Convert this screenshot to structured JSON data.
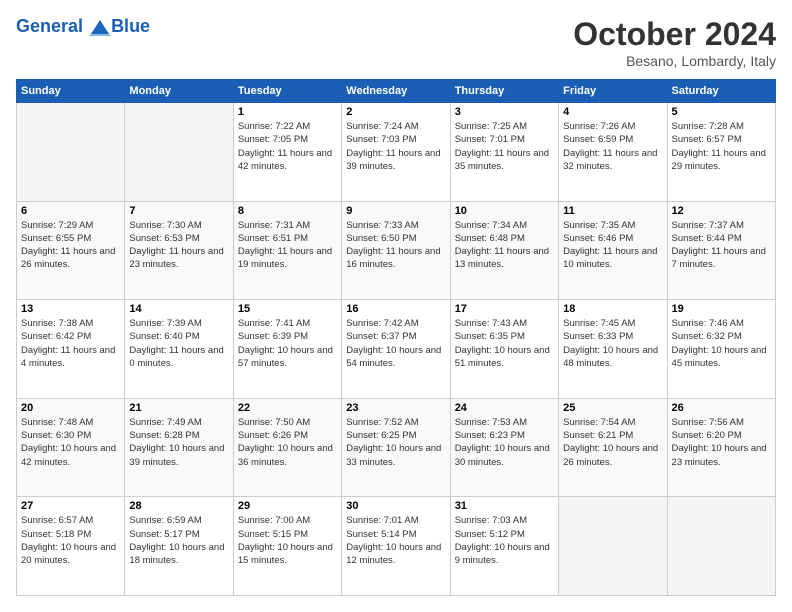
{
  "header": {
    "logo_line1": "General",
    "logo_line2": "Blue",
    "month": "October 2024",
    "location": "Besano, Lombardy, Italy"
  },
  "days_of_week": [
    "Sunday",
    "Monday",
    "Tuesday",
    "Wednesday",
    "Thursday",
    "Friday",
    "Saturday"
  ],
  "weeks": [
    [
      {
        "day": "",
        "info": ""
      },
      {
        "day": "",
        "info": ""
      },
      {
        "day": "1",
        "info": "Sunrise: 7:22 AM\nSunset: 7:05 PM\nDaylight: 11 hours and 42 minutes."
      },
      {
        "day": "2",
        "info": "Sunrise: 7:24 AM\nSunset: 7:03 PM\nDaylight: 11 hours and 39 minutes."
      },
      {
        "day": "3",
        "info": "Sunrise: 7:25 AM\nSunset: 7:01 PM\nDaylight: 11 hours and 35 minutes."
      },
      {
        "day": "4",
        "info": "Sunrise: 7:26 AM\nSunset: 6:59 PM\nDaylight: 11 hours and 32 minutes."
      },
      {
        "day": "5",
        "info": "Sunrise: 7:28 AM\nSunset: 6:57 PM\nDaylight: 11 hours and 29 minutes."
      }
    ],
    [
      {
        "day": "6",
        "info": "Sunrise: 7:29 AM\nSunset: 6:55 PM\nDaylight: 11 hours and 26 minutes."
      },
      {
        "day": "7",
        "info": "Sunrise: 7:30 AM\nSunset: 6:53 PM\nDaylight: 11 hours and 23 minutes."
      },
      {
        "day": "8",
        "info": "Sunrise: 7:31 AM\nSunset: 6:51 PM\nDaylight: 11 hours and 19 minutes."
      },
      {
        "day": "9",
        "info": "Sunrise: 7:33 AM\nSunset: 6:50 PM\nDaylight: 11 hours and 16 minutes."
      },
      {
        "day": "10",
        "info": "Sunrise: 7:34 AM\nSunset: 6:48 PM\nDaylight: 11 hours and 13 minutes."
      },
      {
        "day": "11",
        "info": "Sunrise: 7:35 AM\nSunset: 6:46 PM\nDaylight: 11 hours and 10 minutes."
      },
      {
        "day": "12",
        "info": "Sunrise: 7:37 AM\nSunset: 6:44 PM\nDaylight: 11 hours and 7 minutes."
      }
    ],
    [
      {
        "day": "13",
        "info": "Sunrise: 7:38 AM\nSunset: 6:42 PM\nDaylight: 11 hours and 4 minutes."
      },
      {
        "day": "14",
        "info": "Sunrise: 7:39 AM\nSunset: 6:40 PM\nDaylight: 11 hours and 0 minutes."
      },
      {
        "day": "15",
        "info": "Sunrise: 7:41 AM\nSunset: 6:39 PM\nDaylight: 10 hours and 57 minutes."
      },
      {
        "day": "16",
        "info": "Sunrise: 7:42 AM\nSunset: 6:37 PM\nDaylight: 10 hours and 54 minutes."
      },
      {
        "day": "17",
        "info": "Sunrise: 7:43 AM\nSunset: 6:35 PM\nDaylight: 10 hours and 51 minutes."
      },
      {
        "day": "18",
        "info": "Sunrise: 7:45 AM\nSunset: 6:33 PM\nDaylight: 10 hours and 48 minutes."
      },
      {
        "day": "19",
        "info": "Sunrise: 7:46 AM\nSunset: 6:32 PM\nDaylight: 10 hours and 45 minutes."
      }
    ],
    [
      {
        "day": "20",
        "info": "Sunrise: 7:48 AM\nSunset: 6:30 PM\nDaylight: 10 hours and 42 minutes."
      },
      {
        "day": "21",
        "info": "Sunrise: 7:49 AM\nSunset: 6:28 PM\nDaylight: 10 hours and 39 minutes."
      },
      {
        "day": "22",
        "info": "Sunrise: 7:50 AM\nSunset: 6:26 PM\nDaylight: 10 hours and 36 minutes."
      },
      {
        "day": "23",
        "info": "Sunrise: 7:52 AM\nSunset: 6:25 PM\nDaylight: 10 hours and 33 minutes."
      },
      {
        "day": "24",
        "info": "Sunrise: 7:53 AM\nSunset: 6:23 PM\nDaylight: 10 hours and 30 minutes."
      },
      {
        "day": "25",
        "info": "Sunrise: 7:54 AM\nSunset: 6:21 PM\nDaylight: 10 hours and 26 minutes."
      },
      {
        "day": "26",
        "info": "Sunrise: 7:56 AM\nSunset: 6:20 PM\nDaylight: 10 hours and 23 minutes."
      }
    ],
    [
      {
        "day": "27",
        "info": "Sunrise: 6:57 AM\nSunset: 5:18 PM\nDaylight: 10 hours and 20 minutes."
      },
      {
        "day": "28",
        "info": "Sunrise: 6:59 AM\nSunset: 5:17 PM\nDaylight: 10 hours and 18 minutes."
      },
      {
        "day": "29",
        "info": "Sunrise: 7:00 AM\nSunset: 5:15 PM\nDaylight: 10 hours and 15 minutes."
      },
      {
        "day": "30",
        "info": "Sunrise: 7:01 AM\nSunset: 5:14 PM\nDaylight: 10 hours and 12 minutes."
      },
      {
        "day": "31",
        "info": "Sunrise: 7:03 AM\nSunset: 5:12 PM\nDaylight: 10 hours and 9 minutes."
      },
      {
        "day": "",
        "info": ""
      },
      {
        "day": "",
        "info": ""
      }
    ]
  ]
}
